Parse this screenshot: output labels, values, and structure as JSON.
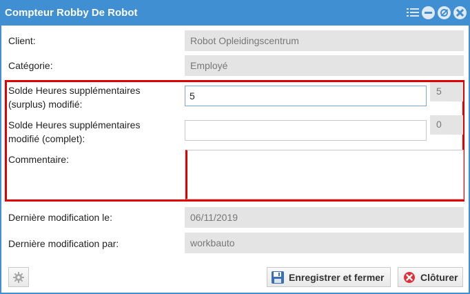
{
  "window": {
    "title": "Compteur Robby De Robot",
    "icons": [
      "list-icon",
      "minimize-icon",
      "ban-icon",
      "close-icon"
    ]
  },
  "form": {
    "client_label": "Client:",
    "client_value": "Robot Opleidingscentrum",
    "category_label": "Catégorie:",
    "category_value": "Employé",
    "surplus_label_line1": "Solde Heures supplémentaires",
    "surplus_label_line2": "(surplus) modifié:",
    "surplus_input": "5",
    "surplus_current": "5",
    "complete_label_line1": "Solde Heures supplémentaires",
    "complete_label_line2": "modifié (complet):",
    "complete_input": "",
    "complete_current": "0",
    "comment_label": "Commentaire:",
    "comment_value": "",
    "last_modified_label": "Dernière modification le:",
    "last_modified_value": "06/11/2019",
    "modified_by_label": "Dernière modification par:",
    "modified_by_value": "workbauto"
  },
  "buttons": {
    "save_label": "Enregistrer et fermer",
    "close_label": "Clôturer"
  },
  "colors": {
    "titlebar": "#3f8fd2",
    "highlight": "#e00000",
    "readonly_bg": "#e4e4e4"
  }
}
